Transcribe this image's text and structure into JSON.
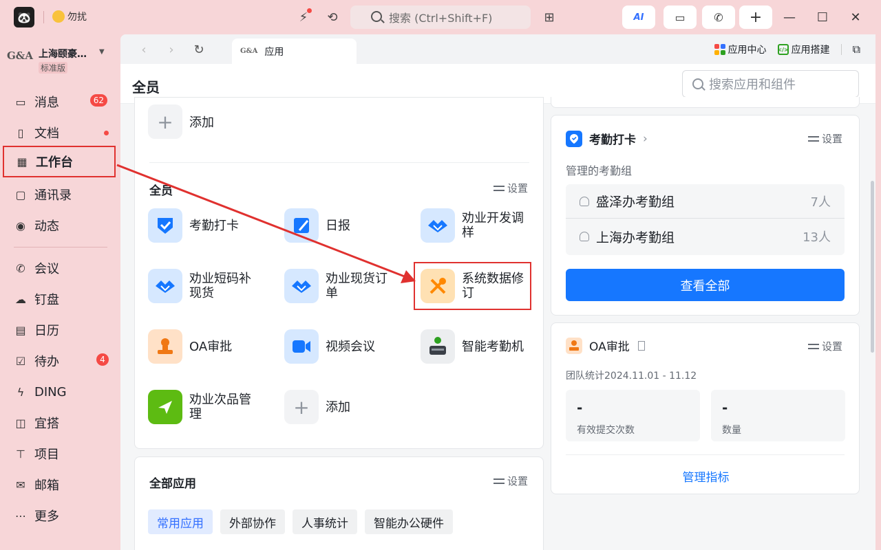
{
  "titlebar": {
    "status_text": "勿扰",
    "search_placeholder": "搜索 (Ctrl+Shift+F)",
    "ai_label": "AI"
  },
  "org": {
    "logo_text": "G&A",
    "name": "上海颐豪…",
    "edition": "标准版"
  },
  "sidebar": {
    "items": [
      {
        "label": "消息",
        "icon": "chat-bubble-icon",
        "badge": "62"
      },
      {
        "label": "文档",
        "icon": "document-icon"
      },
      {
        "label": "工作台",
        "icon": "grid-icon"
      },
      {
        "label": "通讯录",
        "icon": "contacts-icon"
      },
      {
        "label": "动态",
        "icon": "eye-icon"
      },
      {
        "label": "会议",
        "icon": "phone-icon"
      },
      {
        "label": "钉盘",
        "icon": "cloud-icon"
      },
      {
        "label": "日历",
        "icon": "calendar-icon"
      },
      {
        "label": "待办",
        "icon": "todo-icon",
        "badge": "4"
      },
      {
        "label": "DING",
        "icon": "lightning-icon"
      },
      {
        "label": "宜搭",
        "icon": "builder-icon"
      },
      {
        "label": "项目",
        "icon": "project-icon"
      },
      {
        "label": "邮箱",
        "icon": "mail-icon"
      },
      {
        "label": "更多",
        "icon": "more-icon"
      }
    ]
  },
  "tab": {
    "logo_text": "G&A",
    "label": "应用"
  },
  "tabstrip": {
    "app_center": "应用中心",
    "app_builder": "应用搭建"
  },
  "header": {
    "title": "全员",
    "search_placeholder": "搜索应用和组件"
  },
  "apps_card": {
    "top_add": "添加",
    "section_title": "全员",
    "settings": "设置",
    "apps": [
      {
        "label": "考勤打卡",
        "icon": "check-shield-icon"
      },
      {
        "label": "日报",
        "icon": "report-icon"
      },
      {
        "label": "劝业开发调样",
        "icon": "handshake-icon"
      },
      {
        "label": "劝业短码补现货",
        "icon": "handshake-icon"
      },
      {
        "label": "劝业现货订单",
        "icon": "handshake-icon"
      },
      {
        "label": "系统数据修订",
        "icon": "tools-icon"
      },
      {
        "label": "OA审批",
        "icon": "stamp-icon"
      },
      {
        "label": "视频会议",
        "icon": "video-camera-icon"
      },
      {
        "label": "智能考勤机",
        "icon": "attendance-machine-icon"
      },
      {
        "label": "劝业次品管理",
        "icon": "plane-icon"
      },
      {
        "label": "添加",
        "icon": "plus-icon"
      }
    ]
  },
  "all_apps": {
    "title": "全部应用",
    "settings": "设置",
    "chips": [
      "常用应用",
      "外部协作",
      "人事统计",
      "智能办公硬件"
    ]
  },
  "attendance_widget": {
    "title": "考勤打卡",
    "settings": "设置",
    "subtitle": "管理的考勤组",
    "groups": [
      {
        "name": "盛泽办考勤组",
        "count": "7人"
      },
      {
        "name": "上海办考勤组",
        "count": "13人"
      }
    ],
    "button": "查看全部"
  },
  "oa_widget": {
    "title": "OA审批",
    "settings": "设置",
    "stats_label": "团队统计2024.11.01 - 11.12",
    "stats": [
      {
        "value": "-",
        "label": "有效提交次数"
      },
      {
        "value": "-",
        "label": "数量"
      }
    ],
    "link": "管理指标"
  },
  "colors": {
    "accent": "#1677ff",
    "annotation": "#e0312f",
    "badge": "#f54a45"
  }
}
